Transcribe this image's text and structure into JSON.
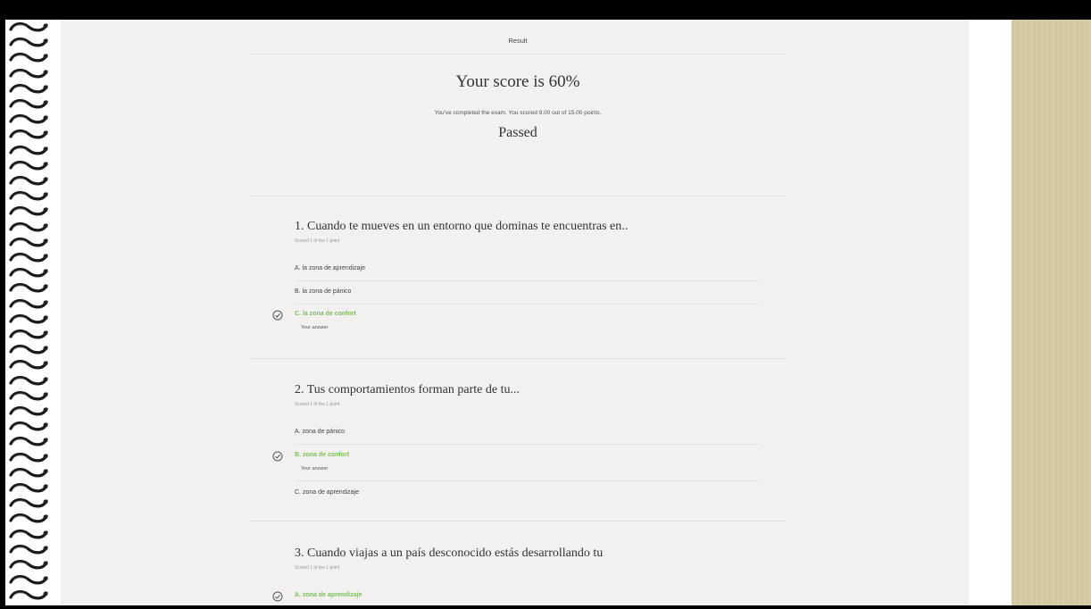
{
  "header": {
    "title": "Result"
  },
  "result": {
    "score_text": "Your score is 60%",
    "summary": "You've completed the exam. You scored 9.00 out of 15.00 points.",
    "status": "Passed"
  },
  "questions": [
    {
      "title": "1. Cuando te mueves en un entorno que dominas te encuentras en..",
      "score": "Scored 1 of the 1 point",
      "options": [
        {
          "label": "A. la zona de aprendizaje"
        },
        {
          "label": "B. la zona de pánico"
        },
        {
          "label": "C. la zona de confort"
        }
      ],
      "your_answer": "Your answer"
    },
    {
      "title": "2. Tus comportamientos forman parte de tu...",
      "score": "Scored 1 of the 1 point",
      "options": [
        {
          "label": "A. zona de pánico"
        },
        {
          "label": "B. zona de confort"
        },
        {
          "label": "C. zona de aprendizaje"
        }
      ],
      "your_answer": "Your answer"
    },
    {
      "title": "3. Cuando viajas a un país desconocido estás desarrollando tu",
      "score": "Scored 1 of the 1 point",
      "options": [
        {
          "label": "A. zona de aprendizaje"
        }
      ]
    }
  ],
  "colors": {
    "correct": "#7bbf5a",
    "page_bg": "#f2f1ef",
    "frame": "#000000",
    "binding_edge": "#d6cca4"
  },
  "icons": {
    "spiral": "spiral-ring-icon",
    "check": "check-circle-icon"
  }
}
